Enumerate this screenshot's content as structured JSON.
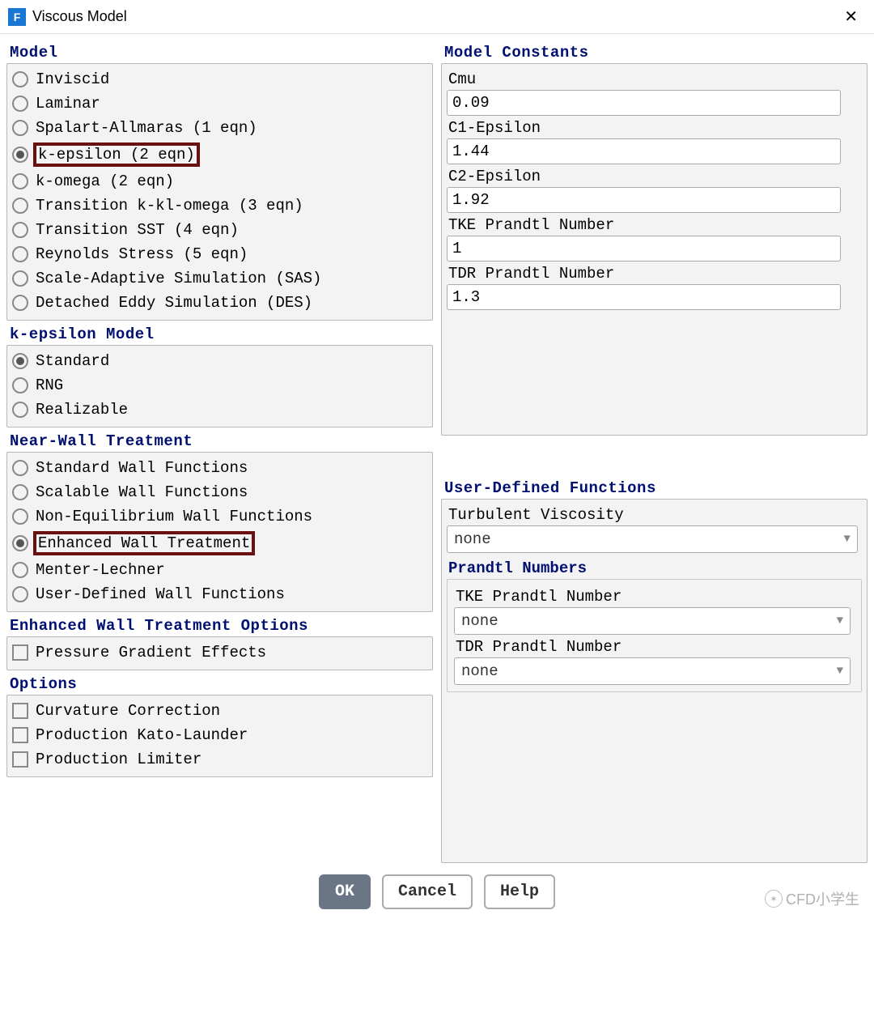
{
  "title": "Viscous Model",
  "sections": {
    "model": {
      "title": "Model",
      "options": [
        {
          "label": "Inviscid",
          "selected": false,
          "highlight": false
        },
        {
          "label": "Laminar",
          "selected": false,
          "highlight": false
        },
        {
          "label": "Spalart-Allmaras (1 eqn)",
          "selected": false,
          "highlight": false
        },
        {
          "label": "k-epsilon (2 eqn)",
          "selected": true,
          "highlight": true
        },
        {
          "label": "k-omega (2 eqn)",
          "selected": false,
          "highlight": false
        },
        {
          "label": "Transition k-kl-omega (3 eqn)",
          "selected": false,
          "highlight": false
        },
        {
          "label": "Transition SST (4 eqn)",
          "selected": false,
          "highlight": false
        },
        {
          "label": "Reynolds Stress (5 eqn)",
          "selected": false,
          "highlight": false
        },
        {
          "label": "Scale-Adaptive Simulation (SAS)",
          "selected": false,
          "highlight": false
        },
        {
          "label": "Detached Eddy Simulation (DES)",
          "selected": false,
          "highlight": false
        }
      ]
    },
    "keModel": {
      "title": "k-epsilon Model",
      "options": [
        {
          "label": "Standard",
          "selected": true
        },
        {
          "label": "RNG",
          "selected": false
        },
        {
          "label": "Realizable",
          "selected": false
        }
      ]
    },
    "nearWall": {
      "title": "Near-Wall Treatment",
      "options": [
        {
          "label": "Standard Wall Functions",
          "selected": false,
          "highlight": false
        },
        {
          "label": "Scalable Wall Functions",
          "selected": false,
          "highlight": false
        },
        {
          "label": "Non-Equilibrium Wall Functions",
          "selected": false,
          "highlight": false
        },
        {
          "label": "Enhanced Wall Treatment",
          "selected": true,
          "highlight": true
        },
        {
          "label": "Menter-Lechner",
          "selected": false,
          "highlight": false
        },
        {
          "label": "User-Defined Wall Functions",
          "selected": false,
          "highlight": false
        }
      ]
    },
    "ewtOptions": {
      "title": "Enhanced Wall Treatment Options",
      "options": [
        {
          "label": "Pressure Gradient Effects",
          "checked": false
        }
      ]
    },
    "options": {
      "title": "Options",
      "options": [
        {
          "label": "Curvature Correction",
          "checked": false
        },
        {
          "label": "Production Kato-Launder",
          "checked": false
        },
        {
          "label": "Production Limiter",
          "checked": false
        }
      ]
    },
    "constants": {
      "title": "Model Constants",
      "fields": [
        {
          "label": "Cmu",
          "value": "0.09"
        },
        {
          "label": "C1-Epsilon",
          "value": "1.44"
        },
        {
          "label": "C2-Epsilon",
          "value": "1.92"
        },
        {
          "label": "TKE Prandtl Number",
          "value": "1"
        },
        {
          "label": "TDR Prandtl Number",
          "value": "1.3"
        }
      ]
    },
    "udf": {
      "title": "User-Defined Functions",
      "turbVisc": {
        "label": "Turbulent Viscosity",
        "value": "none"
      },
      "prandtl": {
        "title": "Prandtl Numbers",
        "fields": [
          {
            "label": "TKE Prandtl Number",
            "value": "none"
          },
          {
            "label": "TDR Prandtl Number",
            "value": "none"
          }
        ]
      }
    }
  },
  "buttons": {
    "ok": "OK",
    "cancel": "Cancel",
    "help": "Help"
  },
  "watermark": "CFD小学生"
}
